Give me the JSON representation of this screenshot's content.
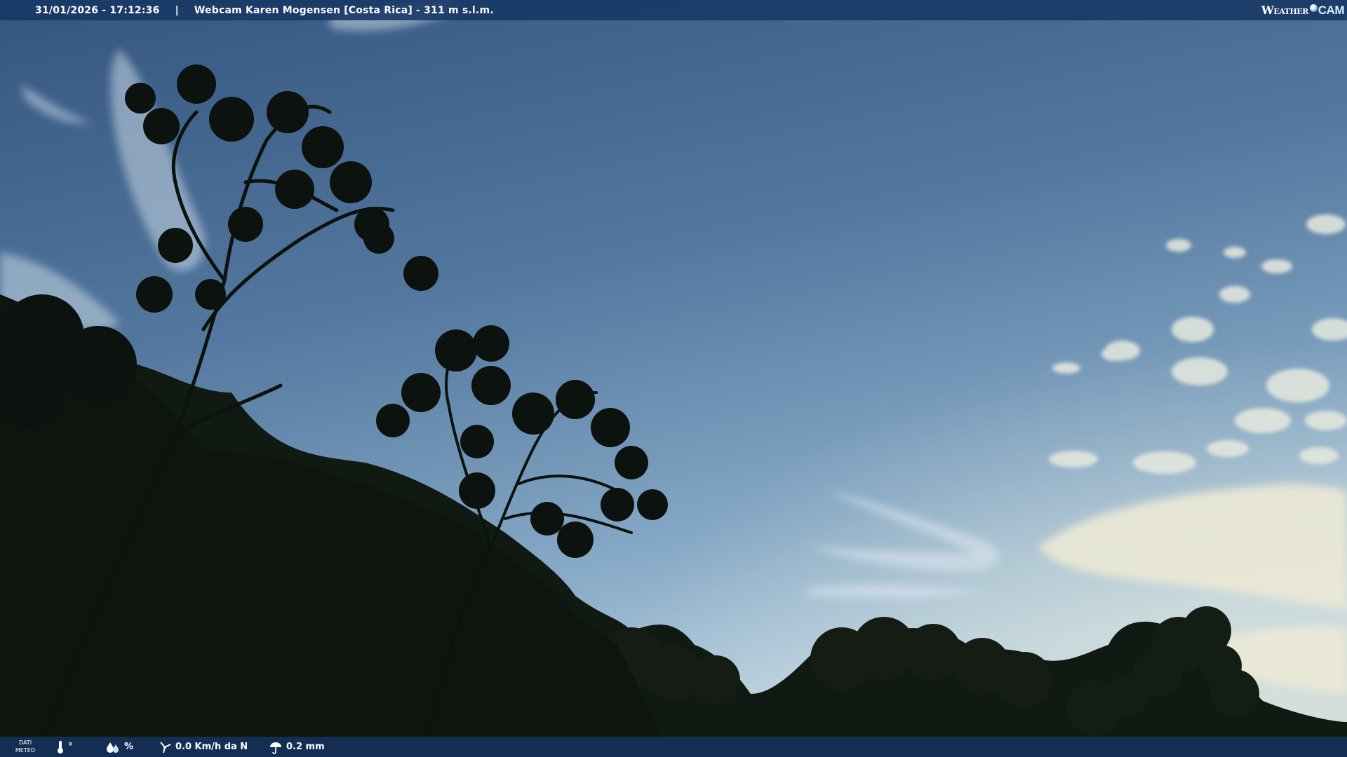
{
  "topbar": {
    "datetime": "31/01/2026 - 17:12:36",
    "separator": "|",
    "title": "Webcam Karen Mogensen [Costa Rica]  - 311 m s.l.m."
  },
  "brand": {
    "weather": "Weather",
    "cam": "CAM"
  },
  "bottombar": {
    "dati_line1": "DATI",
    "dati_line2": "METEO",
    "temperature": "°",
    "humidity": "%",
    "wind": "0.0 Km/h da N",
    "rain": "0.2 mm",
    "icons": [
      "thermometer-icon",
      "humidity-icon",
      "wind-icon",
      "rain-icon"
    ]
  },
  "colors": {
    "bar": "#17376a",
    "sky_top": "#3d5d86",
    "sky_bottom": "#a3c2d8",
    "foliage": "#0f150f"
  }
}
